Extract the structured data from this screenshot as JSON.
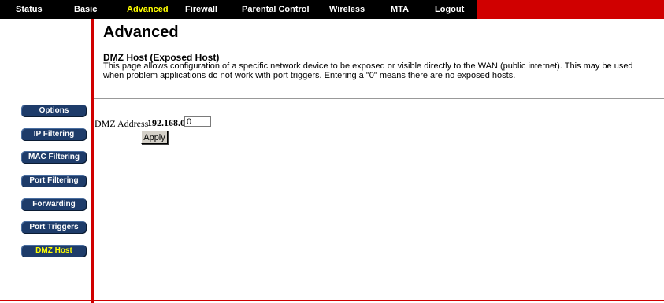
{
  "nav": {
    "items": [
      {
        "label": "Status"
      },
      {
        "label": "Basic"
      },
      {
        "label": "Advanced"
      },
      {
        "label": "Firewall"
      },
      {
        "label": "Parental Control"
      },
      {
        "label": "Wireless"
      },
      {
        "label": "MTA"
      },
      {
        "label": "Logout"
      }
    ]
  },
  "page": {
    "title": "Advanced",
    "section_title": "DMZ Host (Exposed Host)",
    "description": "This page allows configuration of a specific network device to be exposed or visible directly to the WAN (public internet).  This may be used when problem applications do not work with port triggers.  Entering a \"0\" means there are no exposed hosts."
  },
  "sidebar": {
    "items": [
      {
        "label": "Options"
      },
      {
        "label": "IP Filtering"
      },
      {
        "label": "MAC Filtering"
      },
      {
        "label": "Port Filtering"
      },
      {
        "label": "Forwarding"
      },
      {
        "label": "Port Triggers"
      },
      {
        "label": "DMZ Host"
      }
    ]
  },
  "form": {
    "dmz_label": "DMZ Address",
    "dmz_prefix": "192.168.0.",
    "dmz_value": "0",
    "apply_label": "Apply"
  },
  "colors": {
    "nav_bg": "#000000",
    "accent_red": "#d00000",
    "active_text": "#ffff00",
    "button_blue": "#1e3c6a"
  }
}
